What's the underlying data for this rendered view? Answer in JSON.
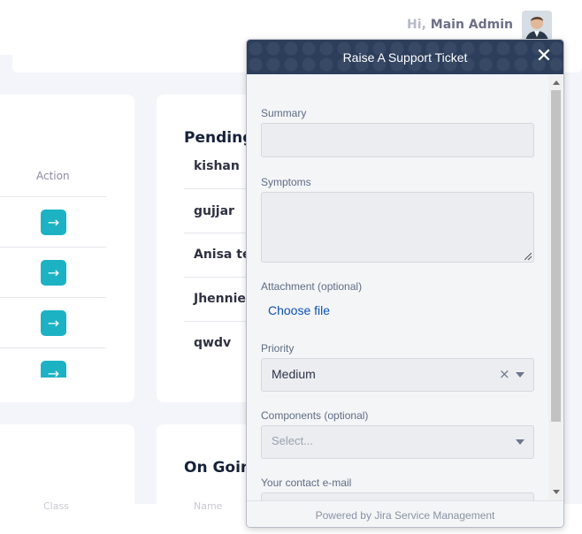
{
  "header": {
    "greeting_prefix": "Hi,",
    "user_name": "Main Admin"
  },
  "left_table": {
    "action_header": "Action",
    "row_button_glyph": "→"
  },
  "pending": {
    "title": "Pending",
    "names": [
      "kishan",
      "gujjar",
      "Anisa tes",
      "Jhenniel",
      "qwdv"
    ]
  },
  "ongoing": {
    "title": "On Goin",
    "col_left": "Class",
    "col_mid": "Name"
  },
  "widget": {
    "title": "Raise A Support Ticket",
    "close_glyph": "✕",
    "summary_label": "Summary",
    "symptoms_label": "Symptoms",
    "attachment_label": "Attachment (optional)",
    "choose_file": "Choose file",
    "priority_label": "Priority",
    "priority_value": "Medium",
    "clear_glyph": "×",
    "components_label": "Components (optional)",
    "components_placeholder": "Select...",
    "email_label": "Your contact e-mail",
    "footer": "Powered by Jira Service Management"
  },
  "colors": {
    "accent_button": "#1cb2c4",
    "widget_header": "#2c3e5b",
    "link": "#0c52b5"
  }
}
